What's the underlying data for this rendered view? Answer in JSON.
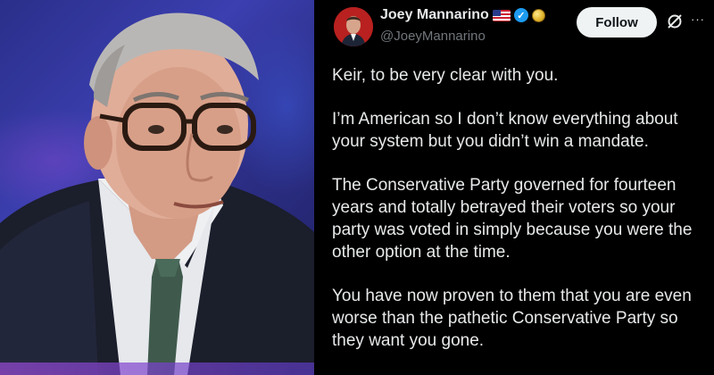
{
  "author": {
    "display_name": "Joey Mannarino",
    "handle": "@JoeyMannarino"
  },
  "follow_label": "Follow",
  "icons": {
    "flag": "us-flag-icon",
    "verified": "verified-badge-icon",
    "coin": "gold-coin-icon",
    "grok": "grok-icon",
    "more": "more-options-icon"
  },
  "colors": {
    "verified": "#1d9bf0",
    "background": "#000000",
    "text": "#e7e9ea",
    "handle": "#71767b"
  },
  "tweet": {
    "paragraphs": [
      "Keir, to be very clear with you.",
      "I’m American so I don’t know everything about your system but you didn’t win a mandate.",
      "The Conservative Party governed for fourteen years and totally betrayed their voters so your party was voted in simply because you were the other option at the time.",
      "You have now proven to them that you are even worse than the pathetic Conservative Party so they want you gone."
    ]
  }
}
